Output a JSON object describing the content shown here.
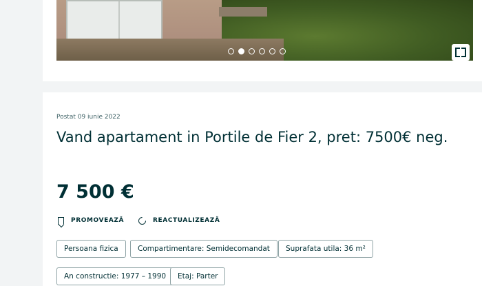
{
  "gallery": {
    "dot_count": 6,
    "active_dot": 2,
    "expand_icon": "expand-icon"
  },
  "listing": {
    "posted": "Postat 09 iunie 2022",
    "title": "Vand apartament in Portile de Fier 2, pret: 7500€ neg.",
    "price": "7 500 €"
  },
  "actions": {
    "promote_label": "PROMOVEAZĂ",
    "promote_icon": "bookmark-icon",
    "refresh_label": "REACTUALIZEAZĂ",
    "refresh_icon": "refresh-icon"
  },
  "tags": [
    "Persoana fizica",
    "Compartimentare: Semidecomandat",
    "Suprafata utila: 36 m²",
    "An constructie: 1977 – 1990",
    "Etaj: Parter"
  ],
  "colors": {
    "text": "#002f34",
    "page_bg": "#f2f4f5",
    "card_bg": "#ffffff",
    "tag_border": "#8da2a4"
  }
}
